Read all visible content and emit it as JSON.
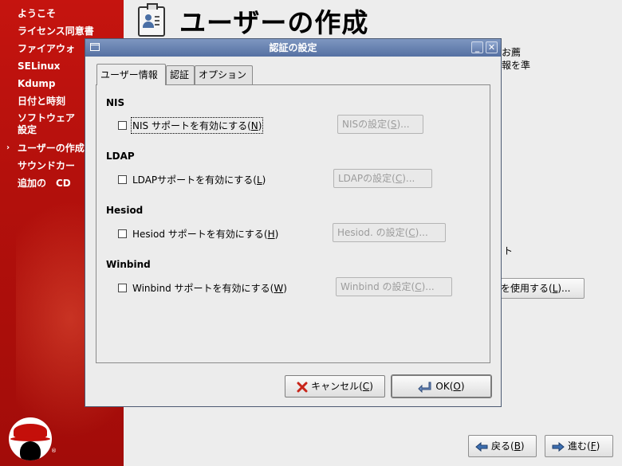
{
  "sidebar": {
    "items": [
      {
        "label": "ようこそ",
        "current": false
      },
      {
        "label": "ライセンス同意書",
        "current": false
      },
      {
        "label": "ファイアウォ",
        "current": false
      },
      {
        "label": "SELinux",
        "current": false
      },
      {
        "label": "Kdump",
        "current": false
      },
      {
        "label": "日付と時刻",
        "current": false
      },
      {
        "label_line1": "ソフトウェア",
        "label_line2": "設定",
        "current": false
      },
      {
        "label": "ユーザーの作成",
        "current": true
      },
      {
        "label": "サウンドカー",
        "current": false
      },
      {
        "label": "追加の　CD",
        "current": false
      }
    ],
    "current_marker": "›",
    "registered_mark": "®"
  },
  "main": {
    "title": "ユーザーの作成",
    "obscured_text": [
      "お薦",
      "報を準",
      "ト"
    ],
    "network_login_button_visible": "を使用する(",
    "network_login_mnemonic": "L",
    "network_login_tail": ")...",
    "back_button": {
      "label": "戻る(",
      "mnemonic": "B",
      "tail": ")"
    },
    "forward_button": {
      "label": "進む(",
      "mnemonic": "F",
      "tail": ")"
    }
  },
  "dialog": {
    "title": "認証の設定",
    "minimize_glyph": "_",
    "close_glyph": "✕",
    "tabs": [
      {
        "label": "ユーザー情報",
        "active": true
      },
      {
        "label": "認証",
        "active": false
      },
      {
        "label": "オプション",
        "active": false
      }
    ],
    "sections": {
      "nis": {
        "heading": "NIS",
        "check_label": "NIS サポートを有効にする(",
        "mnemonic": "N",
        "tail": ")",
        "checked": false,
        "button": "NISの設定(",
        "button_mnemonic": "S",
        "button_tail": ")..."
      },
      "ldap": {
        "heading": "LDAP",
        "check_label": "LDAPサポートを有効にする(",
        "mnemonic": "L",
        "tail": ")",
        "checked": false,
        "button": "LDAPの設定(",
        "button_mnemonic": "C",
        "button_tail": ")..."
      },
      "hesiod": {
        "heading": "Hesiod",
        "check_label": "Hesiod サポートを有効にする(",
        "mnemonic": "H",
        "tail": ")",
        "checked": false,
        "button": "Hesiod. の設定(",
        "button_mnemonic": "C",
        "button_tail": ")..."
      },
      "winbind": {
        "heading": "Winbind",
        "check_label": "Winbind サポートを有効にする(",
        "mnemonic": "W",
        "tail": ")",
        "checked": false,
        "button": "Winbind の設定(",
        "button_mnemonic": "C",
        "button_tail": ")..."
      }
    },
    "cancel_button": {
      "label": "キャンセル(",
      "mnemonic": "C",
      "tail": ")"
    },
    "ok_button": {
      "label": "OK(",
      "mnemonic": "O",
      "tail": ")"
    }
  },
  "colors": {
    "sidebar_red": "#c5140f",
    "titlebar_blue": "#5570a2",
    "cancel_icon_red": "#c8251a"
  }
}
